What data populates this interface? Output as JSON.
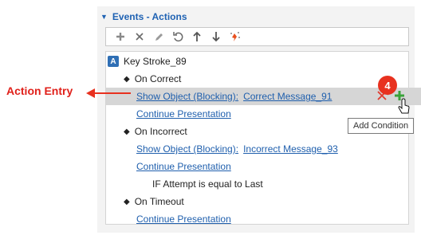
{
  "panel": {
    "title": "Events - Actions",
    "toolbar": [
      {
        "name": "add-icon"
      },
      {
        "name": "delete-icon"
      },
      {
        "name": "edit-icon"
      },
      {
        "name": "undo-icon"
      },
      {
        "name": "move-up-icon"
      },
      {
        "name": "move-down-icon"
      },
      {
        "name": "magic-wand-icon"
      }
    ],
    "object_badge": "A",
    "object_name": "Key Stroke_89",
    "rows": {
      "on_correct": "On Correct",
      "action1_type": "Show Object (Blocking):",
      "action1_target": "Correct Message_91",
      "continue1": "Continue Presentation",
      "on_incorrect": "On Incorrect",
      "action2_type": "Show Object (Blocking):",
      "action2_target": "Incorrect Message_93",
      "continue2": "Continue Presentation",
      "condition": "IF Attempt is equal to Last",
      "on_timeout": "On Timeout",
      "continue3": "Continue Presentation"
    }
  },
  "annotation": {
    "callout_number": "4",
    "action_entry_label": "Action Entry",
    "tooltip": "Add Condition",
    "accent_color": "#e8311f"
  }
}
